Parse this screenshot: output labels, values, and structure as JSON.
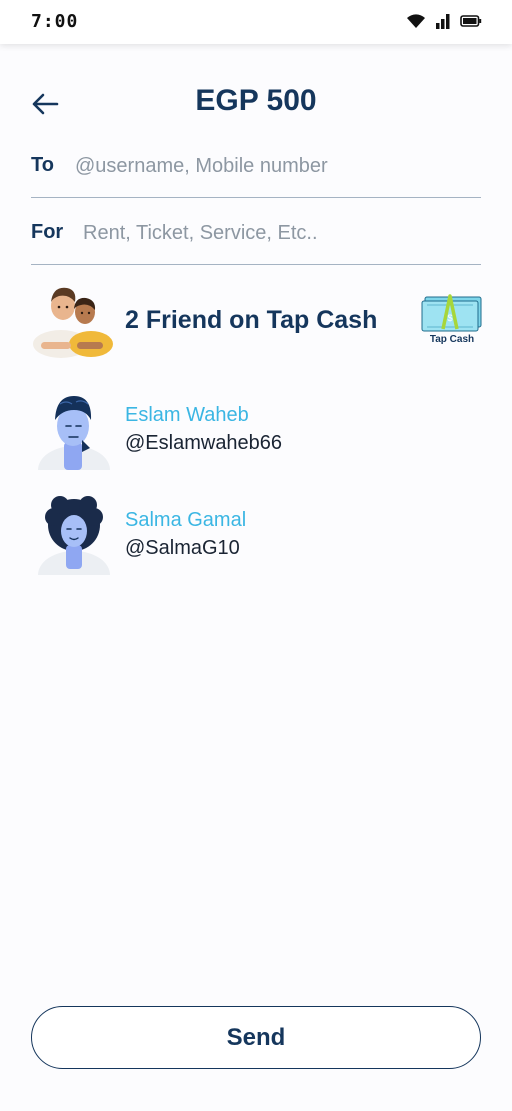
{
  "status_bar": {
    "time": "7:00",
    "icons": [
      "wifi-icon",
      "signal-icon",
      "battery-icon"
    ]
  },
  "header": {
    "back_icon": "arrow-left-icon",
    "title": "EGP 500"
  },
  "form": {
    "to": {
      "label": "To",
      "placeholder": "@username, Mobile number",
      "value": ""
    },
    "for": {
      "label": "For",
      "placeholder": "Rent, Ticket, Service, Etc..",
      "value": ""
    }
  },
  "friends_section": {
    "title": "2 Friend on Tap Cash",
    "logo_label": "Tap Cash"
  },
  "contacts": [
    {
      "name": "Eslam Waheb",
      "handle": "@Eslamwaheb66"
    },
    {
      "name": "Salma Gamal",
      "handle": "@SalmaG10"
    }
  ],
  "actions": {
    "send_label": "Send"
  },
  "colors": {
    "primary": "#15365c",
    "accent": "#3bb6e3",
    "background": "#fcfcfe",
    "divider": "#a5b3c3"
  }
}
